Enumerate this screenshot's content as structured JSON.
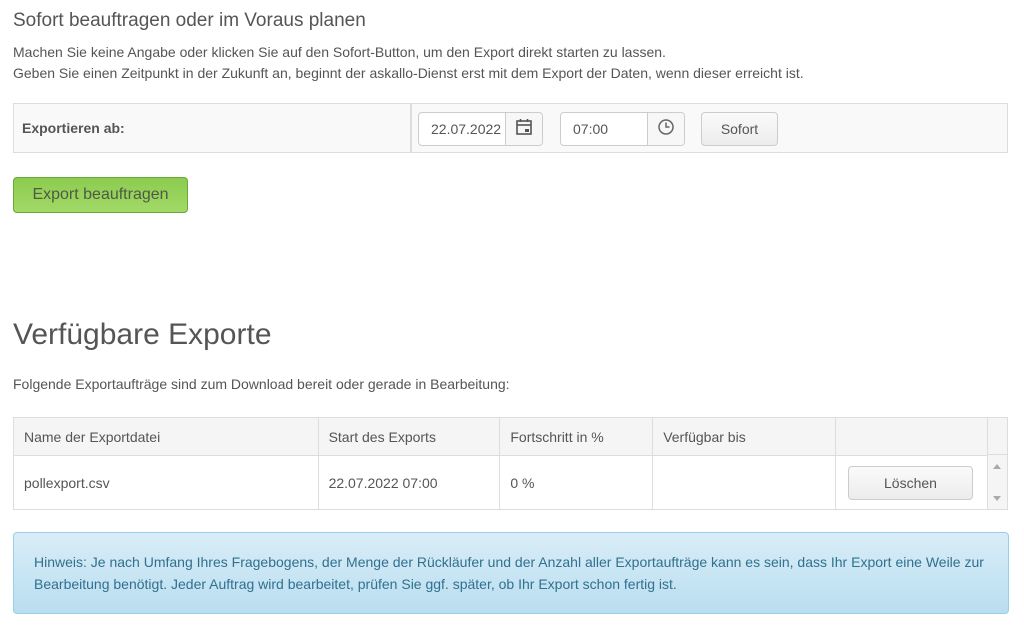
{
  "schedule": {
    "title": "Sofort beauftragen oder im Voraus planen",
    "description_line1": "Machen Sie keine Angabe oder klicken Sie auf den Sofort-Button, um den Export direkt starten zu lassen.",
    "description_line2": "Geben Sie einen Zeitpunkt in der Zukunft an, beginnt der askallo-Dienst erst mit dem Export der Daten, wenn dieser erreicht ist.",
    "export_from_label": "Exportieren ab:",
    "date_value": "22.07.2022",
    "date_icon": "calendar-icon",
    "time_value": "07:00",
    "time_icon": "clock-icon",
    "now_button": "Sofort",
    "submit_button": "Export beauftragen",
    "submit_color": "#8ccc4f"
  },
  "exports": {
    "title": "Verfügbare Exporte",
    "description": "Folgende Exportaufträge sind zum Download bereit oder gerade in Bearbeitung:",
    "columns": [
      "Name der Exportdatei",
      "Start des Exports",
      "Fortschritt in %",
      "Verfügbar bis",
      ""
    ],
    "rows": [
      {
        "name": "pollexport.csv",
        "start": "22.07.2022 07:00",
        "progress": "0 %",
        "available_until": "",
        "delete_button": "Löschen"
      }
    ]
  },
  "notice": {
    "text": "Hinweis: Je nach Umfang Ihres Fragebogens, der Menge der Rückläufer und der Anzahl aller Exportaufträge kann es sein, dass Ihr Export eine Weile zur Bearbeitung benötigt. Jeder Auftrag wird bearbeitet, prüfen Sie ggf. später, ob Ihr Export schon fertig ist.",
    "color": "#31708f"
  }
}
